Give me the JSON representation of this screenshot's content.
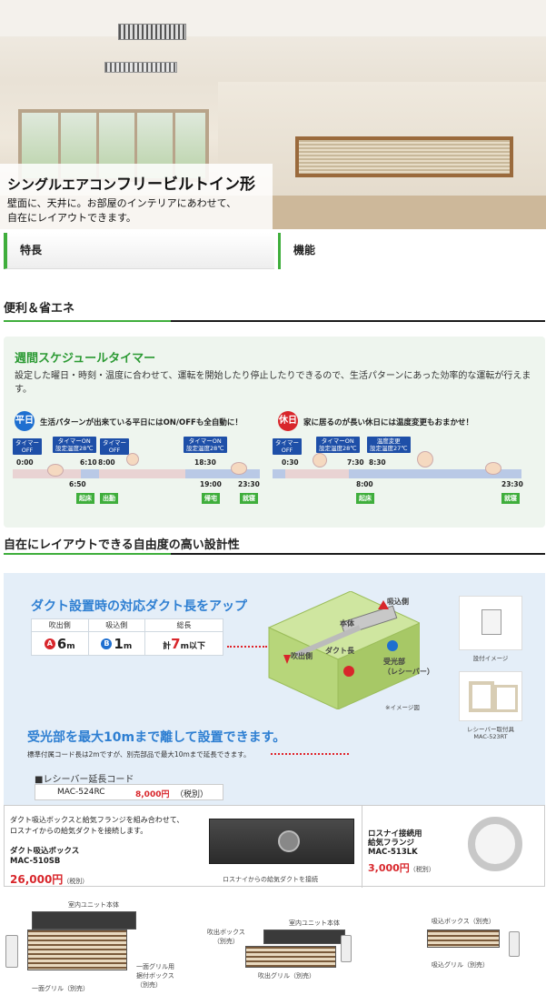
{
  "hero": {
    "title_prefix": "シングルエアコン",
    "title_main": "フリービルトイン形",
    "desc_line1": "壁面に、天井に。お部屋のインテリアにあわせて、",
    "desc_line2": "自在にレイアウトできます。"
  },
  "tabs": {
    "features": "特長",
    "functions": "機能"
  },
  "section1": {
    "heading": "便利＆省エネ"
  },
  "timer": {
    "title": "週間スケジュールタイマー",
    "desc": "設定した曜日・時刻・温度に合わせて、運転を開始したり停止したりできるので、生活パターンにあった効率的な運転が行えます。",
    "weekday": {
      "badge": "平日",
      "lead": "生活パターンが出来ている平日にはON/OFFも全自動に！",
      "events": [
        {
          "label": "タイマー\nOFF",
          "time": "0:00"
        },
        {
          "label": "タイマーON\n設定温度28℃",
          "time": "6:10"
        },
        {
          "label": "タイマー\nOFF",
          "time": "8:00"
        },
        {
          "label": "タイマーON\n設定温度28℃",
          "time": "18:30"
        }
      ],
      "times_below": [
        "6:50",
        "19:00",
        "23:30"
      ],
      "tags": [
        "起床",
        "出勤",
        "帰宅",
        "就寝"
      ]
    },
    "holiday": {
      "badge": "休日",
      "lead": "家に居るのが長い休日には温度変更もおまかせ！",
      "events": [
        {
          "label": "タイマー\nOFF",
          "time": "0:30"
        },
        {
          "label": "タイマーON\n設定温度28℃",
          "time": "7:30"
        },
        {
          "label": "温度変更\n設定温度27℃",
          "time": "8:30"
        }
      ],
      "times_below": [
        "8:00",
        "23:30"
      ],
      "tags": [
        "起床",
        "就寝"
      ]
    }
  },
  "section2": {
    "heading": "自在にレイアウトできる自由度の高い設計性"
  },
  "duct": {
    "title": "ダクト設置時の対応ダクト長をアップ",
    "table": {
      "headers": [
        "吹出側",
        "吸込側",
        "総長"
      ],
      "a_label": "A",
      "a_value": "6",
      "a_unit": "m",
      "b_label": "B",
      "b_value": "1",
      "b_unit": "m",
      "total_prefix": "計",
      "total_value": "7",
      "total_unit": "m以下"
    },
    "diagram": {
      "intake": "吸込側",
      "body": "本体",
      "outlet": "吹出側",
      "duct_len": "ダクト長",
      "receiver": "受光部\n（レシーバー）",
      "note": "※イメージ図"
    },
    "big": "受光部を最大10mまで離して設置できます。",
    "note": "標準付属コード長は2mですが、別売部品で最大10mまで延長できます。",
    "recv_label": "■レシーバー延長コード",
    "recv_model": "MAC-524RC",
    "recv_price": "8,000円",
    "recv_tax": "（税別）",
    "img1_caption": "設付イメージ",
    "img2_caption": "レシーバー取付具\nMAC-523RT"
  },
  "box": {
    "desc1": "ダクト吸込ボックスと給気フランジを組み合わせて、",
    "desc2": "ロスナイからの給気ダクトを接続します。",
    "name1": "ダクト吸込ボックス",
    "model1": "MAC-510SB",
    "price1": "26,000円",
    "tax": "（税別）",
    "img_caption": "ロスナイからの給気ダクトを接続",
    "name2": "ロスナイ接続用",
    "name2b": "給気フランジ",
    "model2": "MAC-513LK",
    "price2": "3,000円"
  },
  "units": {
    "u1_top": "室内ユニット本体",
    "u1_right": "一面グリル用\n据付ボックス\n（別売）",
    "u1_bottom": "一面グリル（別売）",
    "u2_top": "室内ユニット本体",
    "u2_left": "吹出ボックス\n（別売）",
    "u2_bottom": "吹出グリル（別売）",
    "u3_top": "吸込ボックス（別売）",
    "u3_bottom": "吸込グリル（別売）"
  },
  "colors": {
    "green": "#3fae3c",
    "blue": "#2e7fd2",
    "red": "#d8262b"
  }
}
